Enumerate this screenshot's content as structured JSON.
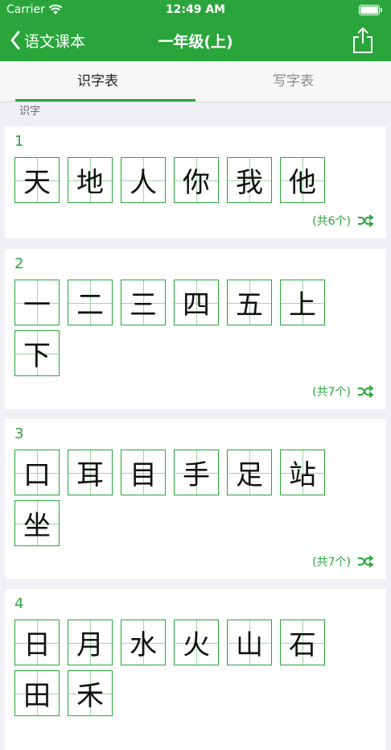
{
  "status_bar": {
    "carrier": "Carrier",
    "time": "12:49 AM"
  },
  "nav": {
    "back_label": "语文课本",
    "title": "一年级(上)"
  },
  "tabs": [
    {
      "label": "识字表",
      "active": true
    },
    {
      "label": "写字表",
      "active": false
    }
  ],
  "section_label": "识字",
  "colors": {
    "accent": "#2aa53c",
    "background": "#efeff4"
  },
  "lessons": [
    {
      "number": "1",
      "characters": [
        "天",
        "地",
        "人",
        "你",
        "我",
        "他"
      ],
      "count_label": "(共6个)"
    },
    {
      "number": "2",
      "characters": [
        "一",
        "二",
        "三",
        "四",
        "五",
        "上",
        "下"
      ],
      "count_label": "(共7个)"
    },
    {
      "number": "3",
      "characters": [
        "口",
        "耳",
        "目",
        "手",
        "足",
        "站",
        "坐"
      ],
      "count_label": "(共7个)"
    },
    {
      "number": "4",
      "characters": [
        "日",
        "月",
        "水",
        "火",
        "山",
        "石",
        "田",
        "禾"
      ],
      "count_label": ""
    }
  ]
}
